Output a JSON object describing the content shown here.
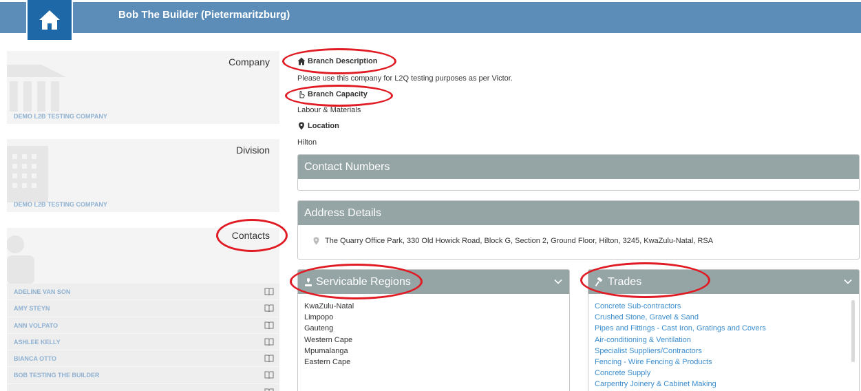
{
  "header": {
    "title": "Bob The Builder (Pietermaritzburg)",
    "home_icon": "home-icon"
  },
  "company_card": {
    "title": "Company",
    "link": "DEMO L2B TESTING COMPANY",
    "icon": "bank-building-icon"
  },
  "division_card": {
    "title": "Division",
    "link": "DEMO L2B TESTING COMPANY",
    "icon": "office-building-icon"
  },
  "contacts_card": {
    "title": "Contacts",
    "icon": "person-icon",
    "contacts": [
      "ADELINE VAN SON",
      "AMY STEYN",
      "ANN VOLPATO",
      "ASHLEE KELLY",
      "BIANCA OTTO",
      "BOB TESTING THE BUILDER"
    ]
  },
  "branch": {
    "description_label": "Branch Description",
    "description": "Please use this company for L2Q testing purposes as per Victor.",
    "capacity_label": "Branch Capacity",
    "capacity": "Labour & Materials",
    "location_label": "Location",
    "location": "Hilton"
  },
  "contact_numbers": {
    "title": "Contact Numbers"
  },
  "address_details": {
    "title": "Address Details",
    "address": "The Quarry Office Park, 330 Old Howick Road, Block G, Section 2, Ground Floor, Hilton, 3245, KwaZulu-Natal, RSA"
  },
  "regions": {
    "title": "Servicable Regions",
    "items": [
      "KwaZulu-Natal",
      "Limpopo",
      "Gauteng",
      "Western Cape",
      "Mpumalanga",
      "Eastern Cape"
    ]
  },
  "trades": {
    "title": "Trades",
    "items": [
      "Concrete Sub-contractors",
      "Crushed Stone, Gravel & Sand",
      "Pipes and Fittings - Cast Iron, Gratings and Covers",
      "Air-conditioning & Ventilation",
      "Specialist Suppliers/Contractors",
      "Fencing - Wire Fencing & Products",
      "Concrete Supply",
      "Carpentry Joinery & Cabinet Making"
    ]
  },
  "colors": {
    "header": "#5b8db8",
    "home_tile": "#1f68a8",
    "panel_head": "#95a5a6",
    "link": "#3a8dcf",
    "annotation": "#e01b24"
  }
}
